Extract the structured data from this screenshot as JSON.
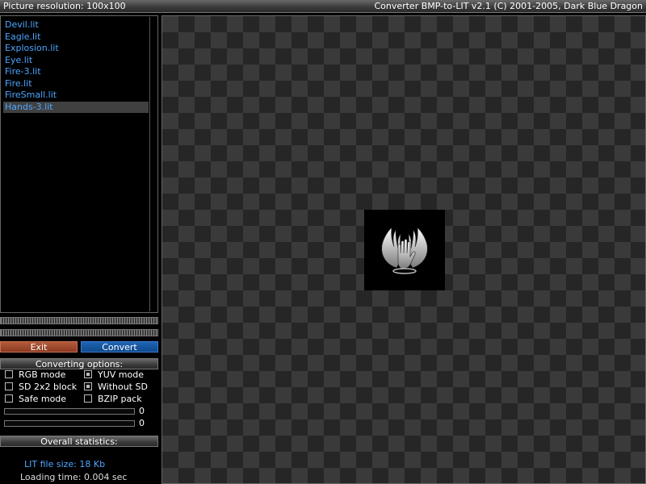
{
  "titlebar": {
    "resolution": "Picture resolution: 100x100",
    "app_title": "Converter BMP-to-LIT v2.1 (C) 2001-2005, Dark Blue Dragon"
  },
  "files": [
    {
      "name": "Devil.lit"
    },
    {
      "name": "Eagle.lit"
    },
    {
      "name": "Explosion.lit"
    },
    {
      "name": "Eye.lit"
    },
    {
      "name": "Fire-3.lit"
    },
    {
      "name": "Fire.lit"
    },
    {
      "name": "FireSmall.lit"
    },
    {
      "name": "Hands-3.lit",
      "selected": true
    }
  ],
  "buttons": {
    "exit": "Exit",
    "convert": "Convert"
  },
  "options": {
    "title": "Converting options:",
    "rgb_mode": {
      "label": "RGB mode",
      "checked": false
    },
    "yuv_mode": {
      "label": "YUV mode",
      "checked": true
    },
    "sd_block": {
      "label": "SD 2x2 block",
      "checked": false
    },
    "without_sd": {
      "label": "Without SD",
      "checked": true
    },
    "safe_mode": {
      "label": "Safe mode",
      "checked": false
    },
    "bzip_pack": {
      "label": "BZIP pack",
      "checked": false
    },
    "slider1_value": "0",
    "slider2_value": "0"
  },
  "stats": {
    "title": "Overall statistics:",
    "file_size": "LIT file size: 18 Kb",
    "loading_time": "Loading time: 0.004 sec"
  },
  "preview": {
    "image_icon": "winged-hand-icon"
  },
  "colors": {
    "file_text": "#4da6ff",
    "exit_button": "#8a3a22",
    "convert_button": "#104a8c"
  }
}
